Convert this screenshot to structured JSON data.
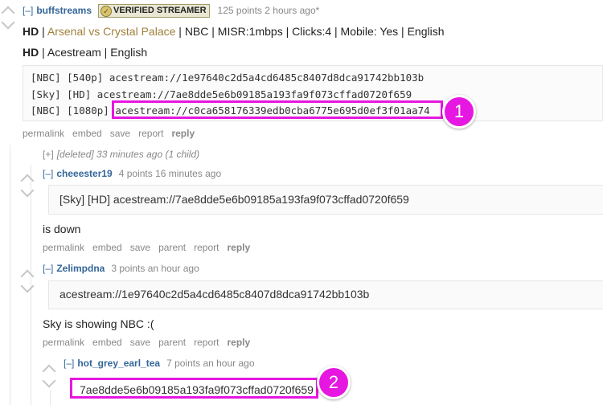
{
  "comment1": {
    "expand": "[–]",
    "author": "buffstreams",
    "badge": "VERIFIED STREAMER",
    "meta": "125 points 2 hours ago*",
    "line1_prefix": "HD",
    "line1_sep1": " | ",
    "line1_link": "Arsenal vs Crystal Palace",
    "line1_rest": " | NBC | MISR:1mbps | Clicks:4 | Mobile: Yes | English",
    "line2_prefix": "HD",
    "line2_rest": " | Acestream | English",
    "code": {
      "line1": "[NBC] [540p] acestream://1e97640c2d5a4cd6485c8407d8dca91742bb103b",
      "line2": "[Sky] [HD] acestream://7ae8dde5e6b09185a193fa9f073cffad0720f659",
      "line3_prefix": "[NBC] [1080p]",
      "line3_link": "acestream://c0ca658176339edb0cba6775e695d0ef3f01aa74"
    },
    "buttons": [
      "permalink",
      "embed",
      "save",
      "report",
      "reply"
    ]
  },
  "deleted": {
    "expand": "[+]",
    "text": "[deleted] 33 minutes ago (1 child)"
  },
  "comment2": {
    "expand": "[–]",
    "author": "cheeester19",
    "meta": "4 points 16 minutes ago",
    "quote": "[Sky] [HD] acestream://7ae8dde5e6b09185a193fa9f073cffad0720f659",
    "body": "is down",
    "buttons": [
      "permalink",
      "embed",
      "save",
      "parent",
      "report",
      "reply"
    ]
  },
  "comment3": {
    "expand": "[–]",
    "author": "Zelimpdna",
    "meta": "3 points an hour ago",
    "quote": "acestream://1e97640c2d5a4cd6485c8407d8dca91742bb103b",
    "body": "Sky is showing NBC :(",
    "buttons": [
      "permalink",
      "embed",
      "save",
      "parent",
      "report",
      "reply"
    ]
  },
  "comment4": {
    "expand": "[–]",
    "author": "hot_grey_earl_tea",
    "meta": "7 points an hour ago",
    "quote": "7ae8dde5e6b09185a193fa9f073cffad0720f659"
  },
  "annotations": {
    "marker1": "1",
    "marker2": "2",
    "color": "#e617e0"
  },
  "colors": {
    "author": "#336699",
    "link": "#a07f3b",
    "meta": "#888888"
  }
}
